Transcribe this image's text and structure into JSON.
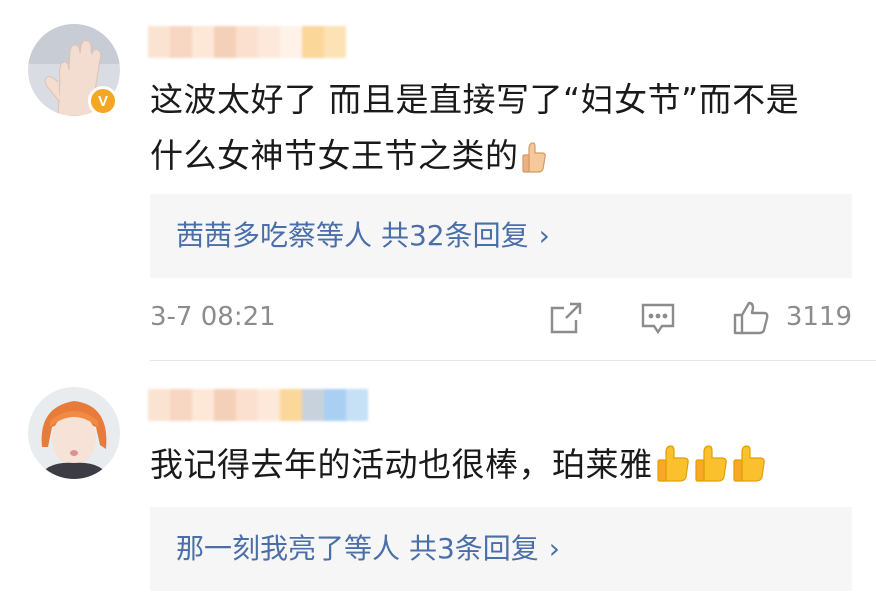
{
  "comments": [
    {
      "text_line1": "这波太好了 而且是直接写了“妇女节”而不是",
      "text_line2": "什么女神节女王节之类的",
      "reply_users": "茜茜多吃蔡",
      "reply_mid": "等人",
      "reply_count": "共32条回复",
      "timestamp": "3-7 08:21",
      "like_count": "3119",
      "verified_badge": "V"
    },
    {
      "text": "我记得去年的活动也很棒，珀莱雅",
      "reply_users": "那一刻我亮了",
      "reply_mid": "等人",
      "reply_count": "共3条回复"
    }
  ],
  "icons": {
    "chevron": "›",
    "share": "share-icon",
    "comment": "comment-icon",
    "like": "thumbs-up-icon"
  },
  "colors": {
    "link_blue": "#4a6fa8",
    "meta_gray": "#8c8c8c",
    "reply_bg": "#f6f6f6",
    "badge_orange": "#f5a623"
  }
}
